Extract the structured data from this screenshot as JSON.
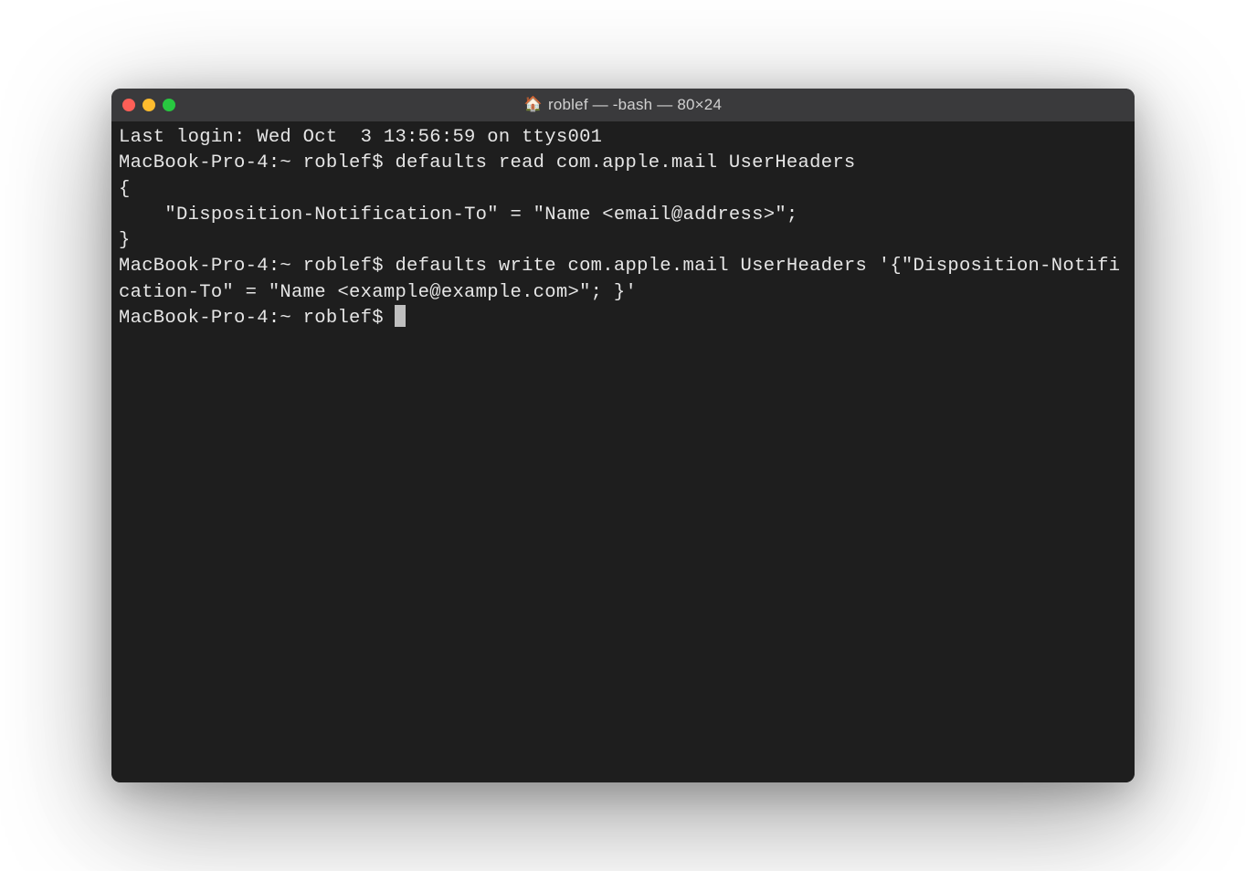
{
  "window": {
    "title_icon": "🏠",
    "title": "roblef — -bash — 80×24"
  },
  "terminal": {
    "lines": [
      "Last login: Wed Oct  3 13:56:59 on ttys001",
      "MacBook-Pro-4:~ roblef$ defaults read com.apple.mail UserHeaders",
      "{",
      "    \"Disposition-Notification-To\" = \"Name <email@address>\";",
      "}",
      "MacBook-Pro-4:~ roblef$ defaults write com.apple.mail UserHeaders '{\"Disposition-Notification-To\" = \"Name <example@example.com>\"; }'",
      "MacBook-Pro-4:~ roblef$ "
    ]
  },
  "colors": {
    "window_bg": "#1e1e1e",
    "titlebar_bg": "#3a3a3c",
    "text": "#e6e6e6",
    "close": "#ff5f57",
    "minimize": "#febc2e",
    "zoom": "#28c840"
  }
}
